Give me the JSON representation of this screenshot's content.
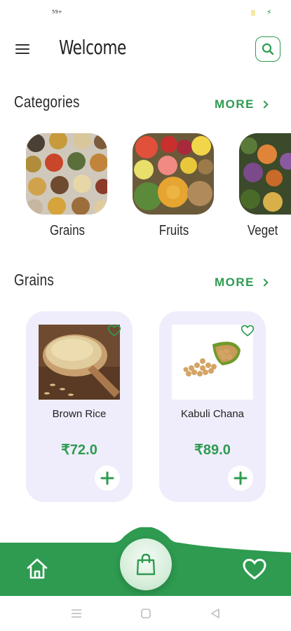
{
  "status_bar": {
    "notification_count": "59+"
  },
  "header": {
    "title": "Welcome"
  },
  "categories_section": {
    "title": "Categories",
    "more_label": "MORE",
    "items": [
      {
        "label": "Grains"
      },
      {
        "label": "Fruits"
      },
      {
        "label": "Veget"
      }
    ]
  },
  "grains_section": {
    "title": "Grains",
    "more_label": "MORE",
    "products": [
      {
        "name": "Brown Rice",
        "price": "₹72.0"
      },
      {
        "name": "Kabuli Chana",
        "price": "₹89.0"
      }
    ]
  },
  "bottom_nav": {
    "items": [
      "home-icon",
      "shopping-bag-icon",
      "heart-icon"
    ]
  },
  "colors": {
    "accent": "#2e9b50",
    "card_bg": "#efedfb",
    "nav_bg": "#2e9b50"
  }
}
